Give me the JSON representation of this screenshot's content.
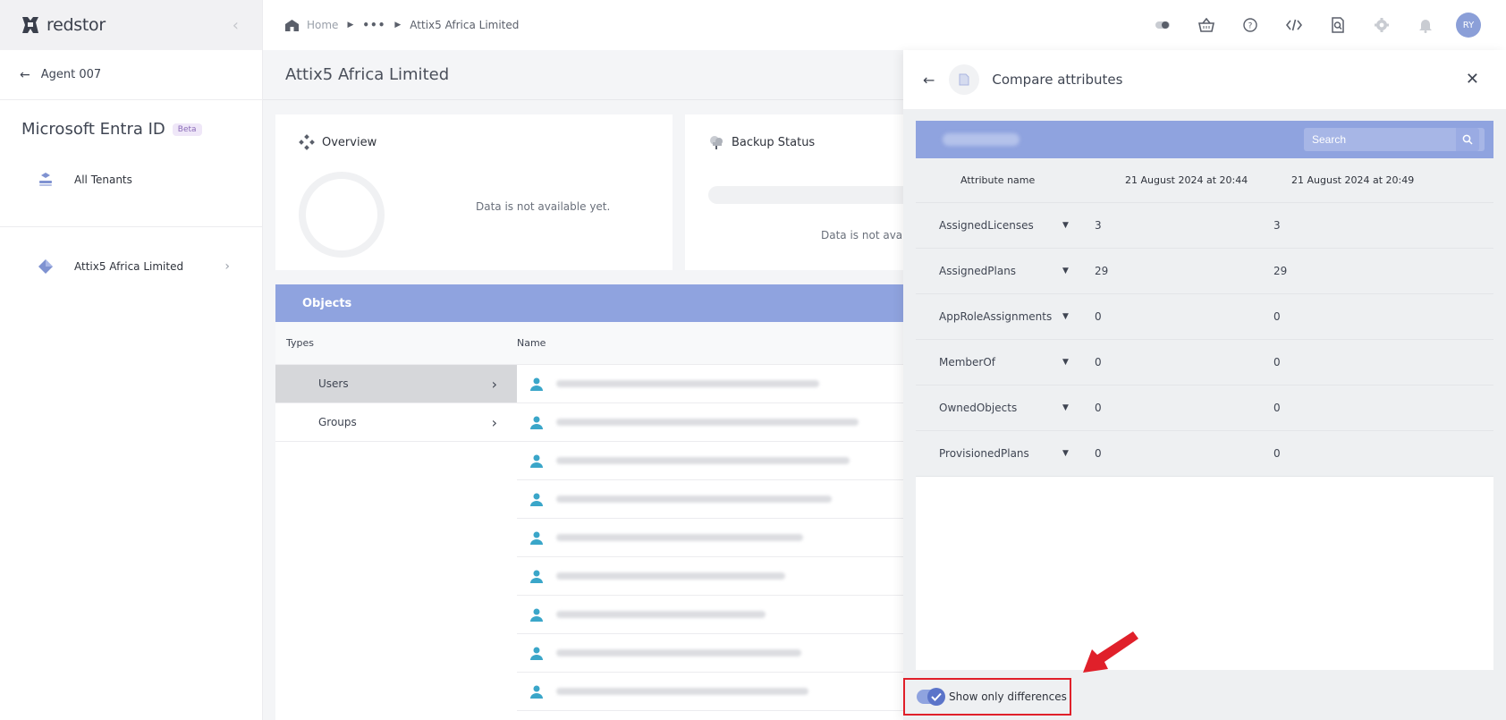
{
  "brand": {
    "name": "redstor"
  },
  "sidebar": {
    "back_label": "Agent 007",
    "product": "Microsoft Entra ID",
    "beta": "Beta",
    "all_tenants": "All Tenants",
    "tenant": "Attix5 Africa Limited"
  },
  "breadcrumb": {
    "home": "Home",
    "dots": "•••",
    "current": "Attix5 Africa Limited"
  },
  "topbar": {
    "avatar": "RY"
  },
  "main": {
    "title": "Attix5 Africa Limited",
    "overview": {
      "title": "Overview",
      "empty": "Data is not available yet."
    },
    "backup": {
      "title": "Backup Status",
      "empty": "Data is not avail"
    },
    "objects": {
      "title": "Objects",
      "col_types": "Types",
      "col_name": "Name",
      "types": [
        "Users",
        "Groups"
      ]
    }
  },
  "panel": {
    "title": "Compare attributes",
    "search_placeholder": "Search",
    "col_attr": "Attribute name",
    "col_date1": "21 August 2024 at 20:44",
    "col_date2": "21 August 2024 at 20:49",
    "rows": [
      {
        "name": "AssignedLicenses",
        "v1": "3",
        "v2": "3"
      },
      {
        "name": "AssignedPlans",
        "v1": "29",
        "v2": "29"
      },
      {
        "name": "AppRoleAssignments",
        "v1": "0",
        "v2": "0"
      },
      {
        "name": "MemberOf",
        "v1": "0",
        "v2": "0"
      },
      {
        "name": "OwnedObjects",
        "v1": "0",
        "v2": "0"
      },
      {
        "name": "ProvisionedPlans",
        "v1": "0",
        "v2": "0"
      }
    ],
    "toggle_label": "Show only differences",
    "toggle_on": true
  },
  "colors": {
    "accent": "#8fa3df",
    "highlight": "#e0202a"
  }
}
